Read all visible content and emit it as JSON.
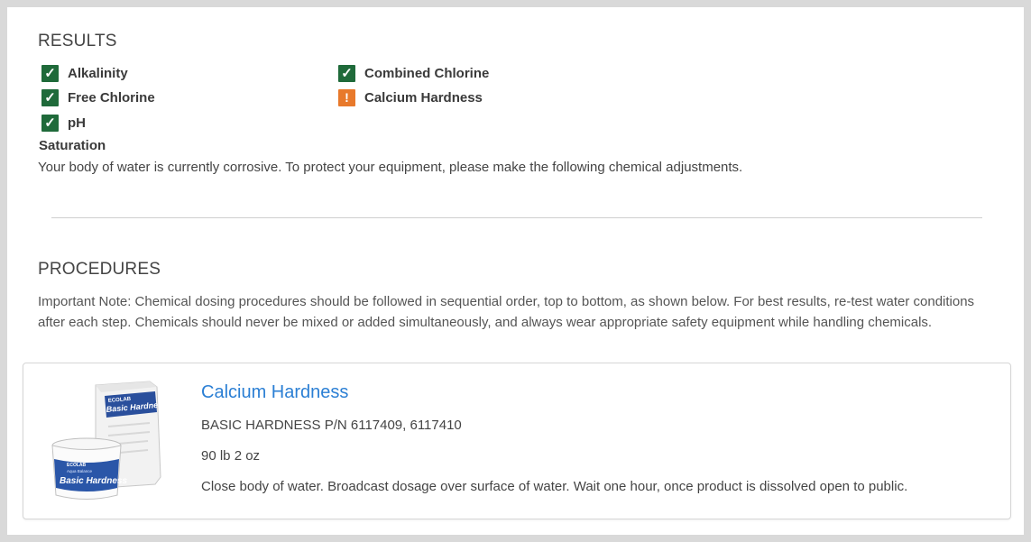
{
  "results": {
    "title": "RESULTS",
    "items": [
      {
        "label": "Alkalinity",
        "status": "ok",
        "icon": "check-icon"
      },
      {
        "label": "Combined Chlorine",
        "status": "ok",
        "icon": "check-icon"
      },
      {
        "label": "Free Chlorine",
        "status": "ok",
        "icon": "check-icon"
      },
      {
        "label": "Calcium Hardness",
        "status": "warning",
        "icon": "exclamation-icon"
      },
      {
        "label": "pH",
        "status": "ok",
        "icon": "check-icon"
      }
    ],
    "saturation_label": "Saturation",
    "saturation_text": "Your body of water is currently corrosive. To protect your equipment, please make the following chemical adjustments."
  },
  "procedures": {
    "title": "PROCEDURES",
    "note": "Important Note: Chemical dosing procedures should be followed in sequential order, top to bottom, as shown below. For best results, re-test water conditions after each step. Chemicals should never be mixed or added simultaneously, and always wear appropriate safety equipment while handling chemicals.",
    "steps": [
      {
        "title": "Calcium Hardness",
        "product": "BASIC HARDNESS P/N 6117409, 6117410",
        "amount": "90 lb 2 oz",
        "instructions": "Close body of water. Broadcast dosage over surface of water. Wait one hour, once product is dissolved open to public.",
        "image_text": {
          "bag_brand": "ECOLAB",
          "bag_name": "Basic Hardness",
          "bucket_brand": "ECOLAB",
          "bucket_sub": "Aqua Balance",
          "bucket_name": "Basic Hardness"
        }
      }
    ]
  },
  "colors": {
    "ok": "#1f6a3a",
    "warning": "#e8792b",
    "link": "#2b7fd4"
  }
}
